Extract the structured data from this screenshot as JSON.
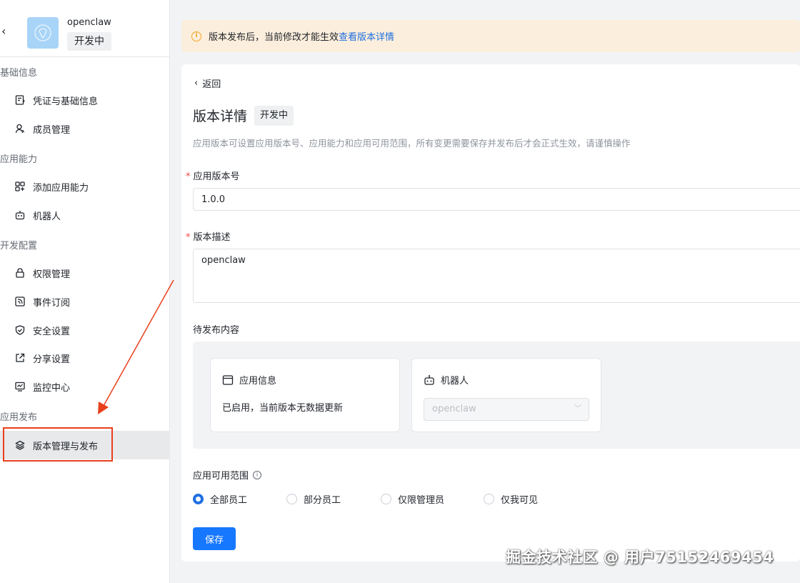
{
  "app": {
    "name": "openclaw",
    "status": "开发中"
  },
  "sidebar": {
    "groups": [
      {
        "title": "基础信息",
        "items": [
          {
            "label": "凭证与基础信息",
            "icon": "credential-icon"
          },
          {
            "label": "成员管理",
            "icon": "member-icon"
          }
        ]
      },
      {
        "title": "应用能力",
        "items": [
          {
            "label": "添加应用能力",
            "icon": "apps-add-icon"
          },
          {
            "label": "机器人",
            "icon": "robot-icon"
          }
        ]
      },
      {
        "title": "开发配置",
        "items": [
          {
            "label": "权限管理",
            "icon": "lock-icon"
          },
          {
            "label": "事件订阅",
            "icon": "rss-icon"
          },
          {
            "label": "安全设置",
            "icon": "shield-icon"
          },
          {
            "label": "分享设置",
            "icon": "share-icon"
          },
          {
            "label": "监控中心",
            "icon": "monitor-icon"
          }
        ]
      },
      {
        "title": "应用发布",
        "items": [
          {
            "label": "版本管理与发布",
            "icon": "layers-icon",
            "active": true
          }
        ]
      }
    ]
  },
  "banner": {
    "text": "版本发布后，当前修改才能生效",
    "link": "查看版本详情"
  },
  "detail": {
    "back_label": "返回",
    "title": "版本详情",
    "status": "开发中",
    "description": "应用版本可设置应用版本号、应用能力和应用可用范围，所有变更需要保存并发布后才会正式生效，请谨慎操作",
    "version_label": "应用版本号",
    "version_value": "1.0.0",
    "desc_label": "版本描述",
    "desc_value": "openclaw",
    "pending_label": "待发布内容",
    "pending_cards": {
      "app_info": {
        "title": "应用信息",
        "text": "已启用，当前版本无数据更新"
      },
      "robot": {
        "title": "机器人",
        "select_value": "openclaw"
      }
    },
    "scope_label": "应用可用范围",
    "scope_options": [
      "全部员工",
      "部分员工",
      "仅限管理员",
      "仅我可见"
    ],
    "scope_selected": "全部员工",
    "save_label": "保存"
  },
  "watermark": "掘金技术社区 @ 用户75152469454",
  "colors": {
    "primary": "#1677ff",
    "link": "#1f6fe0",
    "banner_bg": "#fbeedc",
    "annotation": "#e8401c",
    "required": "#f54a45"
  }
}
